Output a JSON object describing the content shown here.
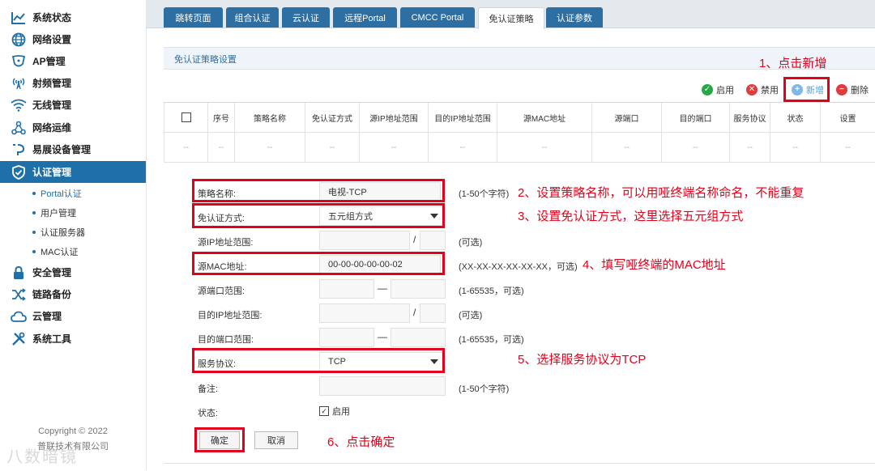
{
  "sidebar": {
    "items": [
      {
        "label": "系统状态",
        "icon": "chart-line-icon"
      },
      {
        "label": "网络设置",
        "icon": "globe-icon"
      },
      {
        "label": "AP管理",
        "icon": "ap-shield-icon"
      },
      {
        "label": "射频管理",
        "icon": "radio-signal-icon"
      },
      {
        "label": "无线管理",
        "icon": "wifi-icon"
      },
      {
        "label": "网络运维",
        "icon": "network-tree-icon"
      },
      {
        "label": "易展设备管理",
        "icon": "device-link-icon"
      },
      {
        "label": "认证管理",
        "icon": "auth-shield-icon"
      },
      {
        "label": "安全管理",
        "icon": "lock-icon"
      },
      {
        "label": "链路备份",
        "icon": "shuffle-icon"
      },
      {
        "label": "云管理",
        "icon": "cloud-icon"
      },
      {
        "label": "系统工具",
        "icon": "tools-icon"
      }
    ],
    "sub_items": [
      "Portal认证",
      "用户管理",
      "认证服务器",
      "MAC认证"
    ],
    "copyright": [
      "Copyright © 2022",
      "普联技术有限公司"
    ],
    "watermark": "​八数暗镜"
  },
  "tabs": [
    "跳转页面",
    "组合认证",
    "云认证",
    "远程Portal",
    "CMCC Portal",
    "免认证策略",
    "认证参数"
  ],
  "active_tab": "免认证策略",
  "section_title": "免认证策略设置",
  "toolbar": {
    "enable": "启用",
    "disable": "禁用",
    "add": "新增",
    "delete": "删除"
  },
  "table": {
    "headers": [
      "序号",
      "策略名称",
      "免认证方式",
      "源IP地址范围",
      "目的IP地址范围",
      "源MAC地址",
      "源端口",
      "目的端口",
      "服务协议",
      "状态",
      "设置"
    ],
    "empty_cell": "--"
  },
  "form": {
    "policy_name": {
      "label": "策略名称:",
      "value": "电视-TCP",
      "hint": "(1-50个字符)"
    },
    "auth_method": {
      "label": "免认证方式:",
      "value": "五元组方式"
    },
    "src_ip": {
      "label": "源IP地址范围:",
      "sep": "/",
      "hint": "(可选)"
    },
    "src_mac": {
      "label": "源MAC地址:",
      "value": "00-00-00-00-00-02",
      "hint": "(XX-XX-XX-XX-XX-XX，可选)"
    },
    "src_port": {
      "label": "源端口范围:",
      "sep": "—",
      "hint": "(1-65535，可选)"
    },
    "dst_ip": {
      "label": "目的IP地址范围:",
      "sep": "/",
      "hint": "(可选)"
    },
    "dst_port": {
      "label": "目的端口范围:",
      "sep": "—",
      "hint": "(1-65535，可选)"
    },
    "protocol": {
      "label": "服务协议:",
      "value": "TCP"
    },
    "remark": {
      "label": "备注:",
      "hint": "(1-50个字符)"
    },
    "status": {
      "label": "状态:",
      "option": "启用",
      "checked": true
    },
    "confirm": "确定",
    "cancel": "取消"
  },
  "annotations": {
    "a1": "1、点击新增",
    "a2": "2、设置策略名称，可以用哑终端名称命名，不能重复",
    "a3": "3、设置免认证方式，这里选择五元组方式",
    "a4": "4、填写哑终端的MAC地址",
    "a5": "5、选择服务协议为TCP",
    "a6": "6、点击确定"
  },
  "colors": {
    "accent": "#1f6fa8",
    "annotation_red": "#e2001a",
    "enable_green": "#27a844",
    "disable_red": "#e23b3b",
    "add_blue": "#4d9fe0"
  }
}
